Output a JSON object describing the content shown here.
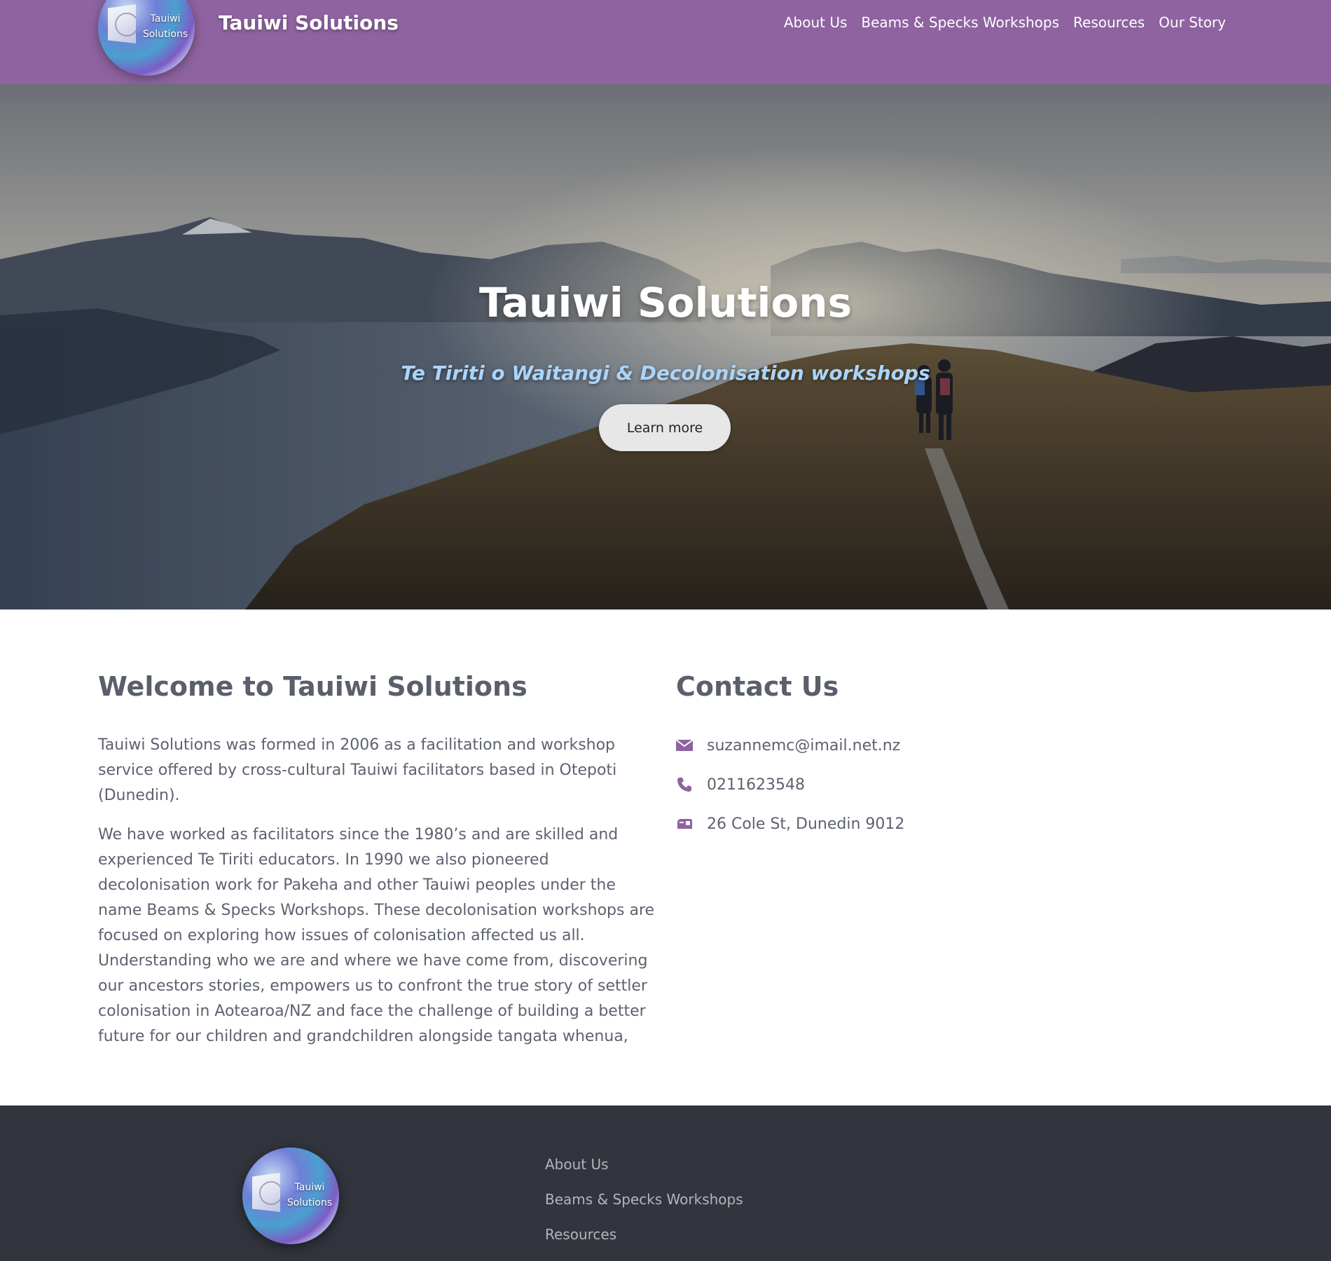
{
  "header": {
    "logo_line1": "Tauiwi",
    "logo_line2": "Solutions",
    "brand_name": "Tauiwi Solutions",
    "nav": [
      {
        "label": "About Us"
      },
      {
        "label": "Beams & Specks Workshops"
      },
      {
        "label": "Resources"
      },
      {
        "label": "Our Story"
      }
    ],
    "background_color": "#8e63a0"
  },
  "hero": {
    "title": "Tauiwi Solutions",
    "subtitle": "Te Tiriti o Waitangi & Decolonisation workshops",
    "button_label": "Learn more",
    "subtitle_color": "#a9d5fb"
  },
  "welcome": {
    "title": "Welcome to Tauiwi Solutions",
    "paragraphs": [
      "Tauiwi Solutions was formed in 2006 as a facilitation and workshop service offered by cross-cultural Tauiwi facilitators based in Otepoti (Dunedin).",
      "We have worked as facilitators since the 1980’s and are skilled and experienced Te Tiriti educators. In 1990 we also pioneered decolonisation work for Pakeha and other Tauiwi peoples under the name Beams & Specks Workshops. These decolonisation workshops are focused on exploring how issues of colonisation affected us all. Understanding who we are and where we have come from, discovering our ancestors stories, empowers us to confront the true story of settler colonisation in Aotearoa/NZ and face the challenge of building a better future for our children and grandchildren alongside tangata whenua,"
    ]
  },
  "contact": {
    "title": "Contact Us",
    "items": [
      {
        "icon": "envelope-icon",
        "text": "suzannemc@imail.net.nz"
      },
      {
        "icon": "phone-icon",
        "text": "0211623548"
      },
      {
        "icon": "mailbox-icon",
        "text": "26 Cole St, Dunedin 9012"
      }
    ],
    "icon_color": "#8e63a0"
  },
  "footer": {
    "logo_line1": "Tauiwi",
    "logo_line2": "Solutions",
    "links": [
      {
        "label": "About Us"
      },
      {
        "label": "Beams & Specks Workshops"
      },
      {
        "label": "Resources"
      }
    ],
    "background_color": "#33353e"
  }
}
